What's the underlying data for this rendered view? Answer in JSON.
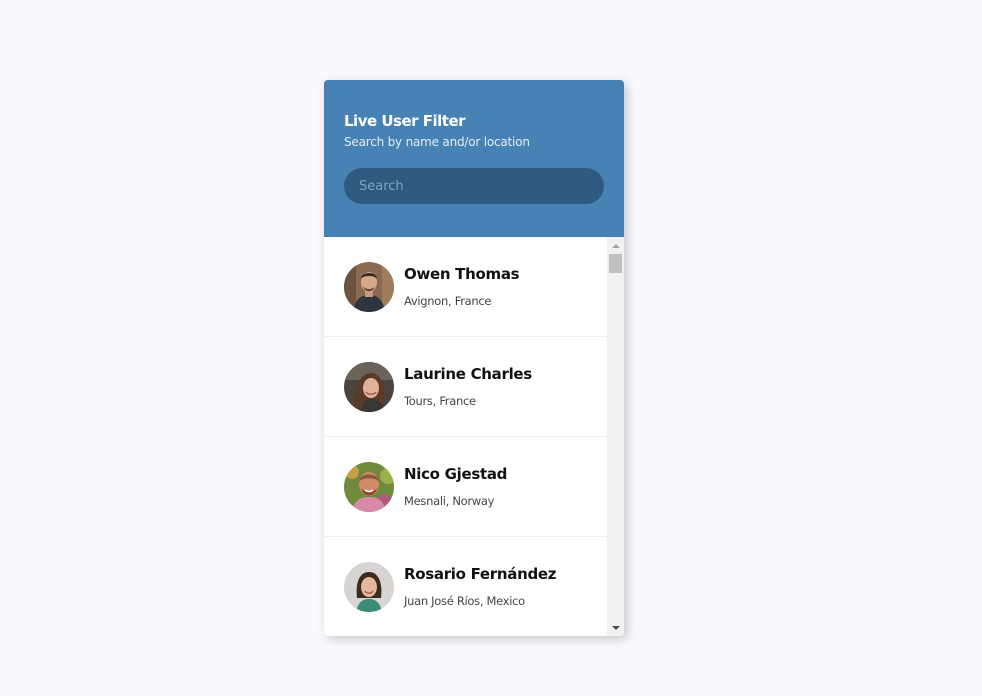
{
  "header": {
    "title": "Live User Filter",
    "subtitle": "Search by name and/or location"
  },
  "search": {
    "placeholder": "Search",
    "value": ""
  },
  "users": [
    {
      "name": "Owen Thomas",
      "location": "Avignon, France"
    },
    {
      "name": "Laurine Charles",
      "location": "Tours, France"
    },
    {
      "name": "Nico Gjestad",
      "location": "Mesnali, Norway"
    },
    {
      "name": "Rosario Fernández",
      "location": "Juan José Ríos, Mexico"
    }
  ],
  "colors": {
    "header_bg": "#4682b4",
    "search_bg": "#2e5a80",
    "page_bg": "#f8f9fd"
  }
}
